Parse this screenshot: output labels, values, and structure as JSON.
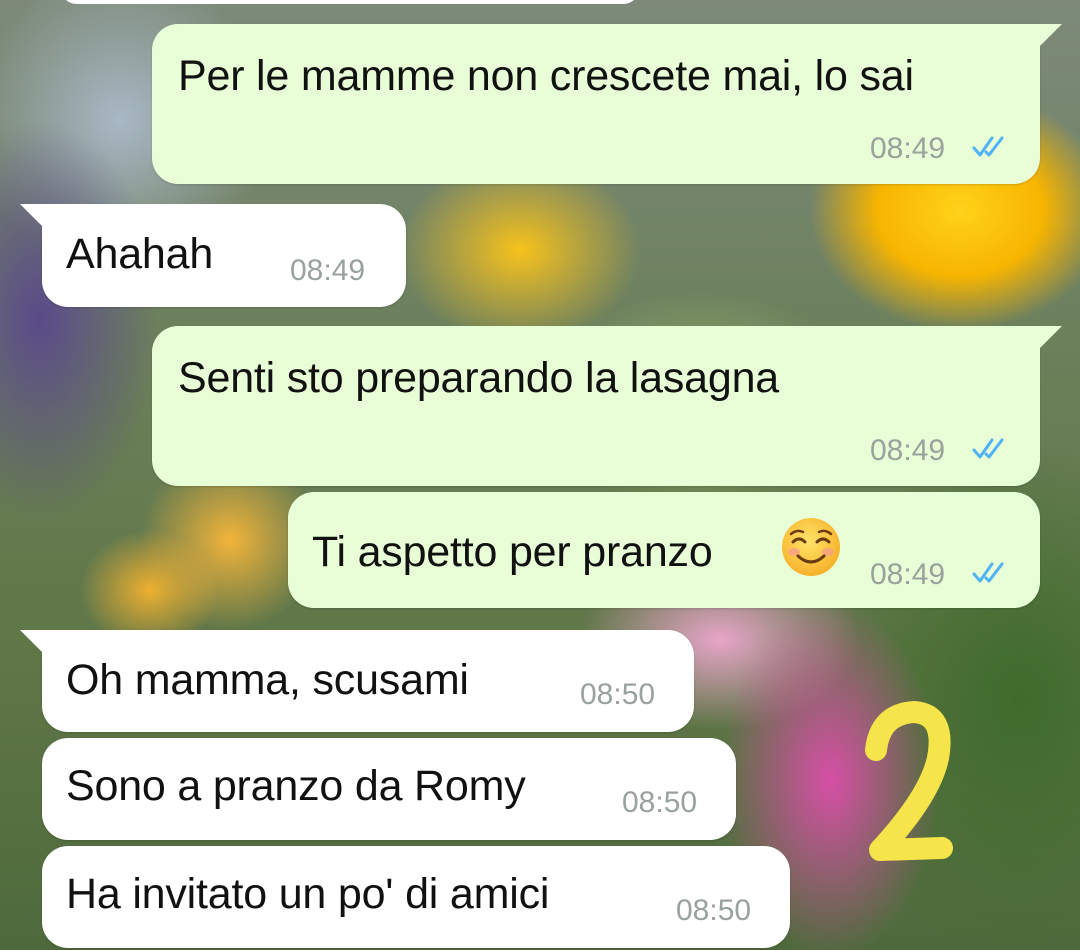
{
  "messages": [
    {
      "text": "Per le mamme non crescete mai, lo sai",
      "time": "08:49",
      "direction": "outgoing",
      "status": "read"
    },
    {
      "text": "Ahahah",
      "time": "08:49",
      "direction": "incoming"
    },
    {
      "text": "Senti sto preparando la lasagna",
      "time": "08:49",
      "direction": "outgoing",
      "status": "read"
    },
    {
      "text": "Ti aspetto per pranzo",
      "time": "08:49",
      "direction": "outgoing",
      "status": "read",
      "emoji": "smiling-face-icon"
    },
    {
      "text": "Oh mamma, scusami",
      "time": "08:50",
      "direction": "incoming"
    },
    {
      "text": "Sono a pranzo da Romy",
      "time": "08:50",
      "direction": "incoming"
    },
    {
      "text": "Ha invitato un po' di amici",
      "time": "08:50",
      "direction": "incoming"
    }
  ],
  "annotation": {
    "label": "2",
    "color": "#f5e44a"
  },
  "colors": {
    "outgoing_bubble": "#e7fed6",
    "incoming_bubble": "#ffffff",
    "read_ticks": "#4fb3f6",
    "timestamp": "#9aa29e"
  }
}
